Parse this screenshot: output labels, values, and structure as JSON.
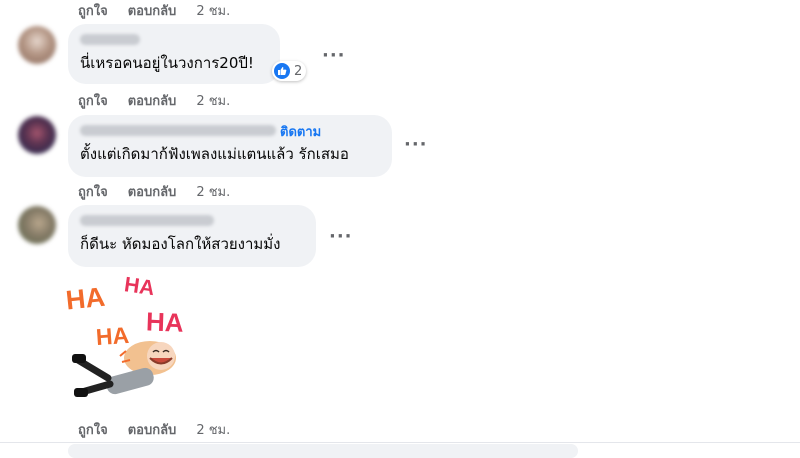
{
  "actions": {
    "like": "ถูกใจ",
    "reply": "ตอบกลับ",
    "time": "2 ชม."
  },
  "comments": [
    {
      "text": "นี่เหรอคนอยู่ในวงการ20ปี!",
      "reactions": "2"
    },
    {
      "text": "ตั้งแต่เกิดมาก้ฟังเพลงแม่แตนแล้ว รักเสมอ",
      "follow": "ติดตาม"
    },
    {
      "text": "ก็ดีนะ หัดมองโลกให้สวยงามมั่ง"
    }
  ],
  "sticker": {
    "ha_words": [
      "HA",
      "HA",
      "HA",
      "HA"
    ],
    "colors": [
      "#f26b2b",
      "#e8345a",
      "#f26b2b",
      "#e8345a"
    ]
  },
  "icons": [
    "like-icon",
    "more-options-icon",
    "avatar"
  ],
  "colors": {
    "bubble": "#f0f2f5",
    "link": "#1877f2",
    "meta": "#65676b"
  }
}
